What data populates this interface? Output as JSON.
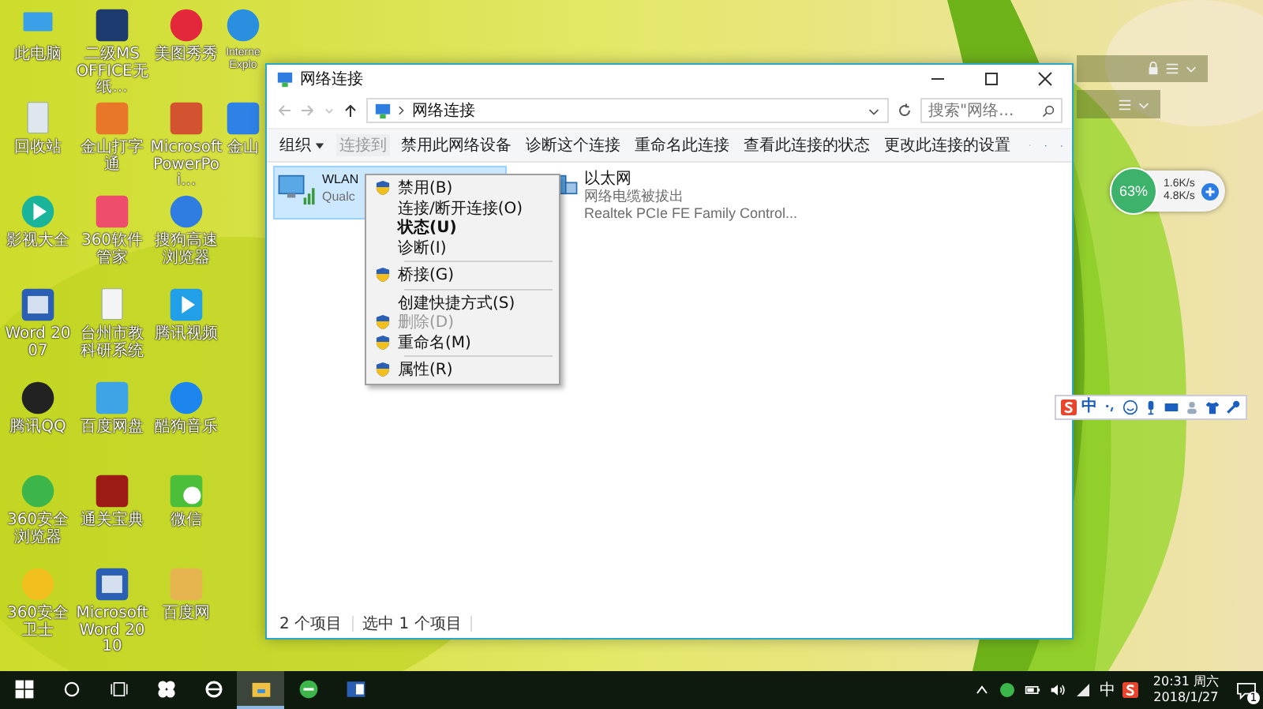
{
  "desktop": {
    "icons": [
      {
        "kind": "pc",
        "label": "此电脑"
      },
      {
        "kind": "recycle",
        "label": "回收站"
      },
      {
        "kind": "video",
        "label": "影视大全"
      },
      {
        "kind": "word",
        "label": "Word 2007"
      },
      {
        "kind": "qq",
        "label": "腾讯QQ"
      },
      {
        "kind": "browser360",
        "label": "360安全浏览器"
      },
      {
        "kind": "guard360",
        "label": "360安全卫士"
      },
      {
        "kind": "book",
        "label": "二级MS OFFICE无纸..."
      },
      {
        "kind": "pinwheel",
        "label": "金山打字通"
      },
      {
        "kind": "apps",
        "label": "360软件管家"
      },
      {
        "kind": "doc",
        "label": "台州市教科研系统"
      },
      {
        "kind": "cloud",
        "label": "百度网盘"
      },
      {
        "kind": "seal",
        "label": "通关宝典"
      },
      {
        "kind": "word",
        "label": "Microsoft Word 2010"
      },
      {
        "kind": "xiu",
        "label": "美图秀秀"
      },
      {
        "kind": "ppt",
        "label": "Microsoft PowerPoi..."
      },
      {
        "kind": "sogou",
        "label": "搜狗高速浏览器"
      },
      {
        "kind": "play",
        "label": "腾讯视频"
      },
      {
        "kind": "kugou",
        "label": "酷狗音乐"
      },
      {
        "kind": "wechat",
        "label": "微信"
      },
      {
        "kind": "user",
        "label": "百度网"
      },
      {
        "kind": "ie",
        "label": "Interne Explo"
      },
      {
        "kind": "dict",
        "label": "金山"
      }
    ]
  },
  "window": {
    "title": "网络连接",
    "address": {
      "path": "网络连接",
      "search_placeholder": "搜索\"网络..."
    },
    "toolbar": [
      {
        "label": "组织",
        "kind": "menu",
        "disabled": false
      },
      {
        "label": "连接到",
        "kind": "button",
        "disabled": true
      },
      {
        "label": "禁用此网络设备",
        "kind": "button",
        "disabled": false
      },
      {
        "label": "诊断这个连接",
        "kind": "button",
        "disabled": false
      },
      {
        "label": "重命名此连接",
        "kind": "button",
        "disabled": false
      },
      {
        "label": "查看此连接的状态",
        "kind": "button",
        "disabled": false
      },
      {
        "label": "更改此连接的设置",
        "kind": "button",
        "disabled": false
      }
    ],
    "connections": [
      {
        "kind": "wifi",
        "name": "WLAN",
        "lines": [
          "Qualc"
        ],
        "selected": true
      },
      {
        "kind": "ethernet",
        "name": "以太网",
        "lines": [
          "网络电缆被拔出",
          "Realtek PCIe FE Family Control..."
        ],
        "selected": false
      }
    ],
    "status_bar": [
      "2 个项目",
      "选中 1 个项目"
    ]
  },
  "context_menu": [
    {
      "kind": "item",
      "label": "禁用(B)",
      "shield": true,
      "bold": false,
      "disabled": false
    },
    {
      "kind": "item",
      "label": "连接/断开连接(O)",
      "shield": false,
      "bold": false,
      "disabled": false
    },
    {
      "kind": "item",
      "label": "状态(U)",
      "shield": false,
      "bold": true,
      "disabled": false
    },
    {
      "kind": "item",
      "label": "诊断(I)",
      "shield": false,
      "bold": false,
      "disabled": false
    },
    {
      "kind": "separator"
    },
    {
      "kind": "item",
      "label": "桥接(G)",
      "shield": true,
      "bold": false,
      "disabled": false
    },
    {
      "kind": "separator"
    },
    {
      "kind": "item",
      "label": "创建快捷方式(S)",
      "shield": false,
      "bold": false,
      "disabled": false
    },
    {
      "kind": "item",
      "label": "删除(D)",
      "shield": true,
      "bold": false,
      "disabled": true
    },
    {
      "kind": "item",
      "label": "重命名(M)",
      "shield": true,
      "bold": false,
      "disabled": false
    },
    {
      "kind": "separator"
    },
    {
      "kind": "item",
      "label": "属性(R)",
      "shield": true,
      "bold": false,
      "disabled": false
    }
  ],
  "speed_widget": {
    "percent": "63%",
    "upload": "1.6K/s",
    "download": "4.8K/s"
  },
  "ime_bar": {
    "mode": "中"
  },
  "taskbar": {
    "apps": [
      {
        "kind": "start",
        "selected": false
      },
      {
        "kind": "search",
        "selected": false
      },
      {
        "kind": "taskview",
        "selected": false
      },
      {
        "kind": "fan",
        "selected": false
      },
      {
        "kind": "ie",
        "selected": false
      },
      {
        "kind": "explorer",
        "selected": true
      },
      {
        "kind": "browser360",
        "selected": false
      },
      {
        "kind": "word",
        "selected": false
      }
    ],
    "ime": "中",
    "time": "20:31 周六",
    "date": "2018/1/27",
    "notifications": "1"
  }
}
